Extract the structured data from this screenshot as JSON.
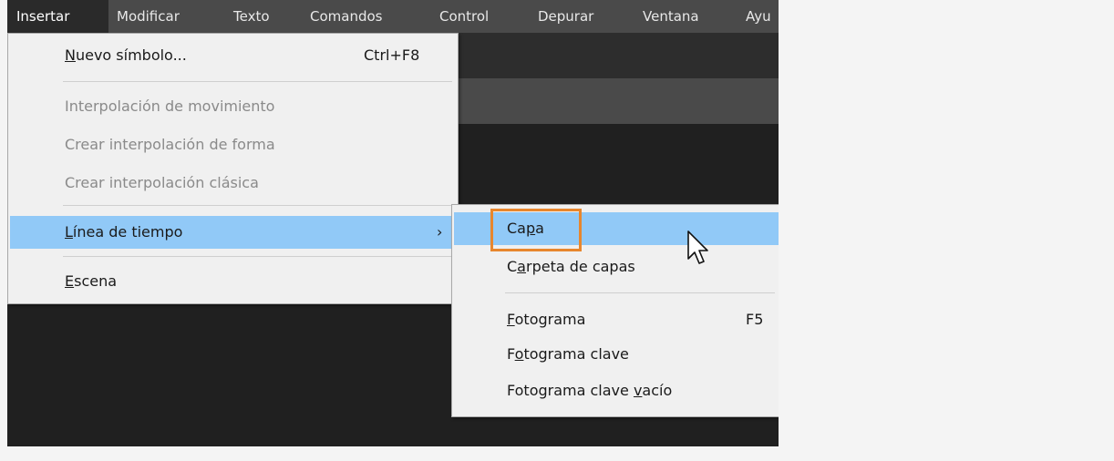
{
  "menubar": {
    "items": [
      {
        "label": "Insertar"
      },
      {
        "label": "Modificar"
      },
      {
        "label": "Texto"
      },
      {
        "label": "Comandos"
      },
      {
        "label": "Control"
      },
      {
        "label": "Depurar"
      },
      {
        "label": "Ventana"
      },
      {
        "label": "Ayu"
      }
    ]
  },
  "insert_menu": {
    "new_symbol": {
      "pre": "",
      "u": "N",
      "post": "uevo símbolo...",
      "shortcut": "Ctrl+F8"
    },
    "motion_tween": {
      "label": "Interpolación de movimiento"
    },
    "shape_tween": {
      "label": "Crear interpolación de forma"
    },
    "classic_tween": {
      "label": "Crear interpolación clásica"
    },
    "timeline": {
      "pre": "",
      "u": "L",
      "post": "ínea de tiempo",
      "arrow": "›"
    },
    "scene": {
      "pre": "",
      "u": "E",
      "post": "scena"
    }
  },
  "timeline_submenu": {
    "layer": {
      "pre": "Ca",
      "u": "p",
      "post": "a"
    },
    "layer_folder": {
      "pre": "C",
      "u": "a",
      "post": "rpeta de capas"
    },
    "frame": {
      "pre": "",
      "u": "F",
      "post": "otograma",
      "shortcut": "F5"
    },
    "keyframe": {
      "pre": "F",
      "u": "o",
      "post": "tograma clave"
    },
    "blank_keyframe": {
      "pre": "Fotograma clave ",
      "u": "v",
      "post": "acío"
    }
  },
  "colors": {
    "highlight": "#91c9f7",
    "focus_outline": "#e8862d",
    "menubar_bg": "#4a4a4a"
  }
}
